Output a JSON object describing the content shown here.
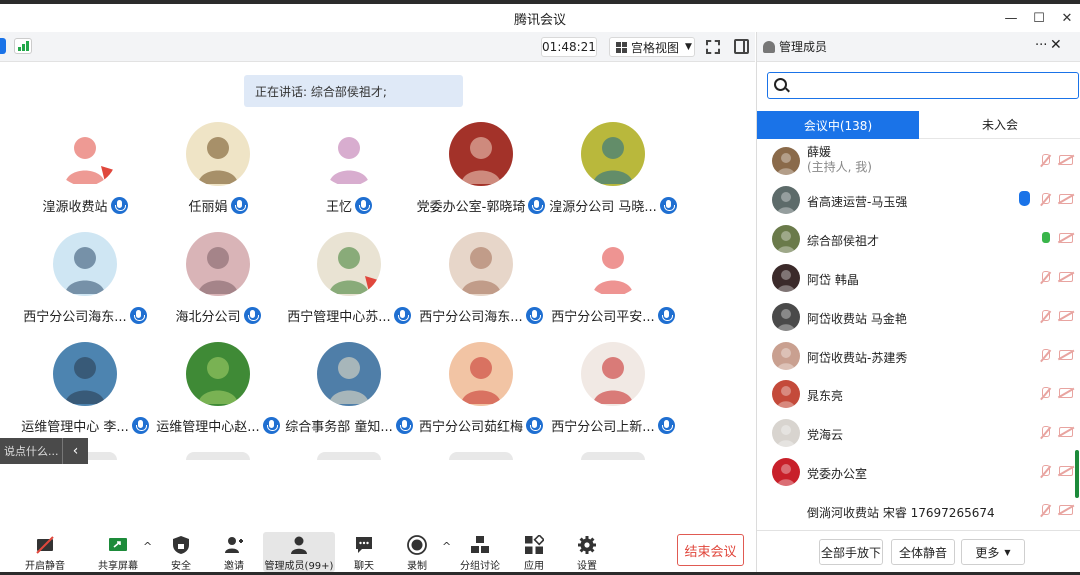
{
  "window": {
    "title": "腾讯会议"
  },
  "topbar": {
    "timer": "01:48:21",
    "view_label": "宫格视图"
  },
  "speaking": {
    "text": "正在讲话: 综合部侯祖才;"
  },
  "tiles": [
    {
      "name": "湟源收费站",
      "bg": "#ffffff",
      "fg": "#e0473c",
      "badge": true
    },
    {
      "name": "任丽娟",
      "bg": "#efe4c6",
      "fg": "#6b4a1d",
      "badge": false
    },
    {
      "name": "王忆",
      "bg": "#ffffff",
      "fg": "#b86aa8",
      "badge": false
    },
    {
      "name": "党委办公室-郭晓琦",
      "bg": "#a33229",
      "fg": "#f2d3c2",
      "badge": false
    },
    {
      "name": "湟源分公司 马晓...",
      "bg": "#b9b83c",
      "fg": "#1e6a8e",
      "badge": false
    },
    {
      "name": "西宁分公司海东...",
      "bg": "#cfe6f3",
      "fg": "#2e4a6a",
      "badge": false
    },
    {
      "name": "海北分公司",
      "bg": "#d9b4b7",
      "fg": "#7a5c64",
      "badge": false
    },
    {
      "name": "西宁管理中心苏...",
      "bg": "#e9e3d3",
      "fg": "#3b7d2f",
      "badge": true
    },
    {
      "name": "西宁分公司海东...",
      "bg": "#e7d6c9",
      "fg": "#a36e53",
      "badge": false
    },
    {
      "name": "西宁分公司平安...",
      "bg": "#ffffff",
      "fg": "#e03c39",
      "badge": false
    },
    {
      "name": "运维管理中心 李...",
      "bg": "#4d84b0",
      "fg": "#28384a",
      "badge": false
    },
    {
      "name": "运维管理中心赵...",
      "bg": "#3f8a36",
      "fg": "#a9d46b",
      "badge": false
    },
    {
      "name": "综合事务部 童知...",
      "bg": "#4f7ea8",
      "fg": "#f0e4c9",
      "badge": false
    },
    {
      "name": "西宁分公司茹红梅",
      "bg": "#f2c4a4",
      "fg": "#c5302a",
      "badge": false
    },
    {
      "name": "西宁分公司上新...",
      "bg": "#f1e9e4",
      "fg": "#c5201f",
      "badge": false
    }
  ],
  "chat_input": {
    "placeholder": "说点什么..."
  },
  "toolbar": {
    "unmute": "开启静音",
    "share": "共享屏幕",
    "security": "安全",
    "invite": "邀请",
    "members": "管理成员(99+)",
    "chat": "聊天",
    "record": "录制",
    "breakout": "分组讨论",
    "apps": "应用",
    "settings": "设置",
    "end": "结束会议"
  },
  "panel": {
    "title": "管理成员",
    "tab_in": "会议中(138)",
    "tab_out": "未入会",
    "participants": [
      {
        "name": "薛媛",
        "sub": "(主持人, 我)",
        "color": "#8a6a4a",
        "mic": "off",
        "hand": false
      },
      {
        "name": "省高速运营-马玉强",
        "sub": "",
        "color": "#5d6b6a",
        "mic": "off",
        "hand": true
      },
      {
        "name": "综合部侯祖才",
        "sub": "",
        "color": "#6a7a4a",
        "mic": "on",
        "hand": false
      },
      {
        "name": "阿岱 韩晶",
        "sub": "",
        "color": "#3b2a2a",
        "mic": "off",
        "hand": false
      },
      {
        "name": "阿岱收费站 马金艳",
        "sub": "",
        "color": "#4a4a4a",
        "mic": "off",
        "hand": false
      },
      {
        "name": "阿岱收费站-苏建秀",
        "sub": "",
        "color": "#c9a090",
        "mic": "off",
        "hand": false
      },
      {
        "name": "晁东亮",
        "sub": "",
        "color": "#c44a3a",
        "mic": "off",
        "hand": false
      },
      {
        "name": "党海云",
        "sub": "",
        "color": "#d8d4cf",
        "mic": "off",
        "hand": false
      },
      {
        "name": "党委办公室",
        "sub": "",
        "color": "#c8202a",
        "mic": "off",
        "hand": false
      },
      {
        "name": "倒淌河收费站 宋睿 17697265674",
        "sub": "",
        "color": "#ffffff",
        "mic": "off",
        "hand": false
      }
    ],
    "raise_all": "全部手放下",
    "mute_all": "全体静音",
    "more": "更多"
  }
}
